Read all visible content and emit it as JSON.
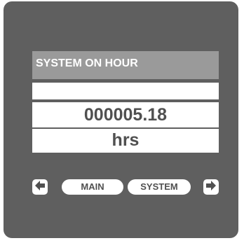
{
  "screen": {
    "title": "SYSTEM ON HOUR",
    "value": "000005.18",
    "unit": "hrs"
  },
  "nav": {
    "left_icon": "arrow-left-icon",
    "right_icon": "arrow-right-icon",
    "softkeys": [
      "MAIN",
      "SYSTEM"
    ]
  },
  "colors": {
    "bezel": "#5f5f5f",
    "title_bar": "#9a9a9a",
    "field_bg": "#ffffff",
    "text": "#505050"
  }
}
